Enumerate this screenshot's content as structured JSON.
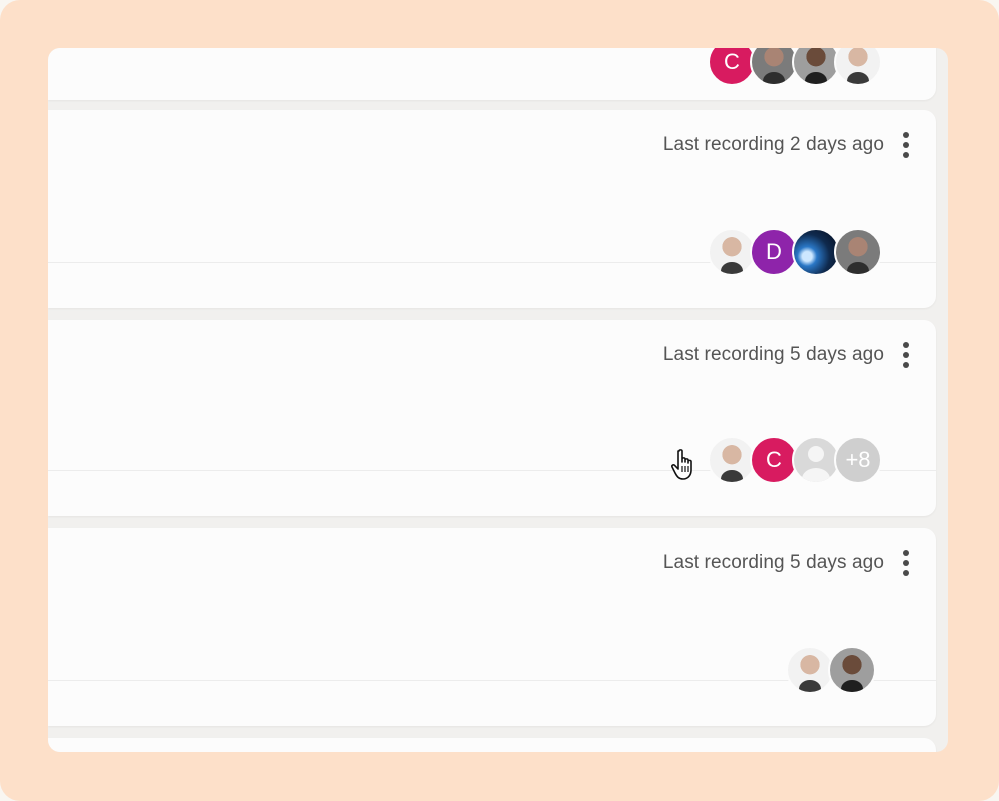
{
  "cards": [
    {
      "recording_text": "",
      "avatars": [
        {
          "type": "letter",
          "letter": "C",
          "color": "#d81b60"
        },
        {
          "type": "photo-b"
        },
        {
          "type": "photo-c"
        },
        {
          "type": "photo-a"
        }
      ]
    },
    {
      "recording_text": "Last recording 2 days ago",
      "avatars": [
        {
          "type": "photo-a"
        },
        {
          "type": "letter",
          "letter": "D",
          "color": "#8e24aa"
        },
        {
          "type": "space"
        },
        {
          "type": "photo-b"
        }
      ]
    },
    {
      "recording_text": "Last recording 5 days ago",
      "avatars": [
        {
          "type": "photo-a"
        },
        {
          "type": "letter",
          "letter": "C",
          "color": "#d81b60"
        },
        {
          "type": "generic"
        },
        {
          "type": "more",
          "label": "+8"
        }
      ]
    },
    {
      "recording_text": "Last recording 5 days ago",
      "avatars": [
        {
          "type": "photo-a"
        },
        {
          "type": "photo-c"
        }
      ]
    }
  ],
  "icons": {
    "menu": "vertical-ellipsis-icon",
    "cursor": "hand-pointer-icon"
  },
  "colors": {
    "frame": "#fde0c9",
    "card": "#fcfcfc",
    "text": "#555555"
  }
}
